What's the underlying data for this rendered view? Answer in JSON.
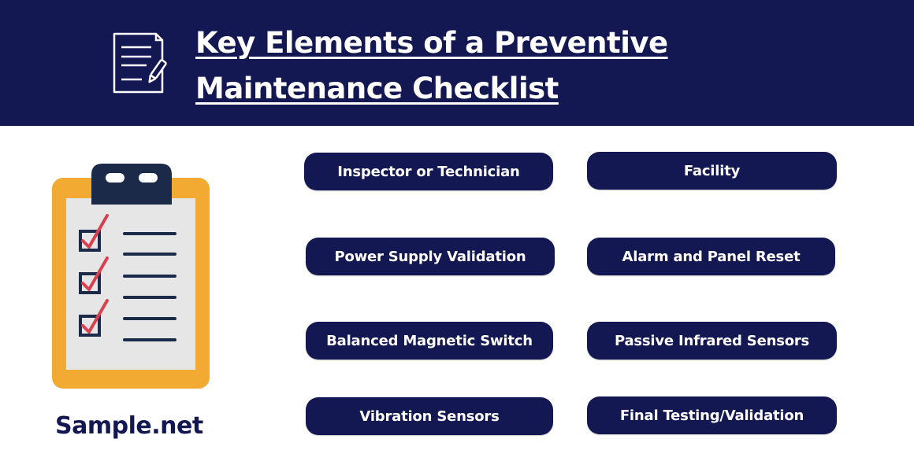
{
  "header": {
    "title_line1": "Key Elements of a Preventive",
    "title_line2": "Maintenance Checklist",
    "icon": "document-edit-icon"
  },
  "illustration": {
    "icon": "clipboard-checklist-icon",
    "checked_items": 3
  },
  "brand": "Sample.net",
  "elements": [
    {
      "label": "Inspector or Technician"
    },
    {
      "label": "Facility"
    },
    {
      "label": "Power Supply Validation"
    },
    {
      "label": "Alarm and Panel Reset"
    },
    {
      "label": "Balanced Magnetic Switch"
    },
    {
      "label": "Passive Infrared Sensors"
    },
    {
      "label": "Vibration Sensors"
    },
    {
      "label": "Final Testing/Validation"
    }
  ],
  "colors": {
    "navy": "#141852",
    "clipboard_orange": "#F2AA33",
    "check_red": "#D9404F",
    "paper_gray": "#E6E6E6"
  }
}
